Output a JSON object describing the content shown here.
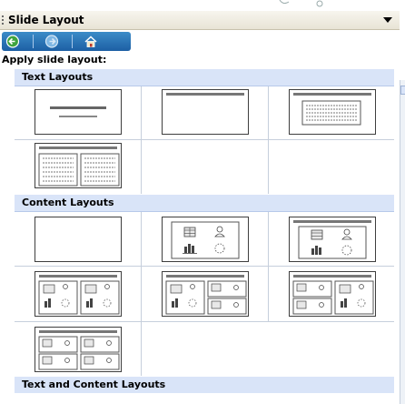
{
  "panel": {
    "title": "Slide Layout",
    "apply_label": "Apply slide layout:"
  },
  "sections": [
    {
      "title": "Text Layouts",
      "layouts": [
        "title-slide",
        "title-only",
        "title-and-text",
        "title-and-two-column-text"
      ]
    },
    {
      "title": "Content Layouts",
      "layouts": [
        "blank",
        "content",
        "title-and-content",
        "title-and-two-content",
        "title-content-and-two-content",
        "title-two-content-and-content",
        "title-and-four-content"
      ]
    },
    {
      "title": "Text and Content Layouts",
      "layouts": []
    }
  ]
}
